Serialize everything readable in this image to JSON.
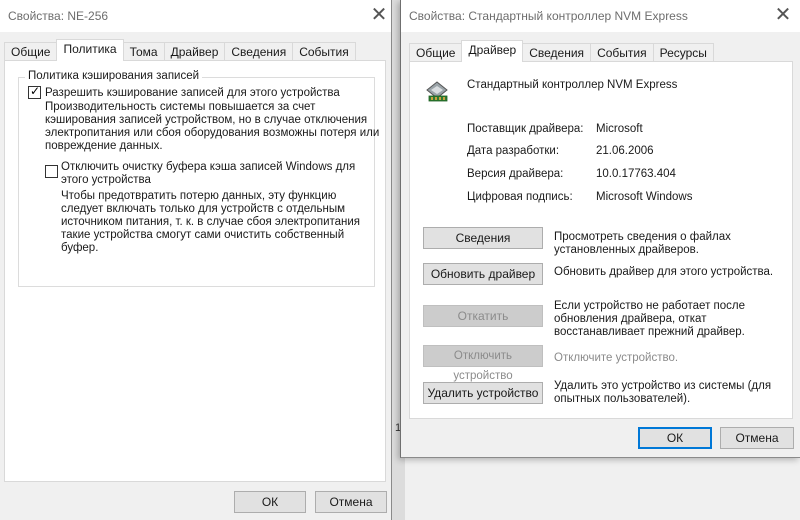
{
  "win1": {
    "title": "Свойства: NE-256",
    "tabs": [
      "Общие",
      "Политика",
      "Тома",
      "Драйвер",
      "Сведения",
      "События"
    ],
    "active_tab": "Политика",
    "group_title": "Политика кэширования записей",
    "option1": {
      "label": "Разрешить кэширование записей для этого устройства",
      "checked": true,
      "desc": [
        "Производительность системы повышается за счет",
        "кэширования записей устройством, но в случае отключения",
        "электропитания или сбоя оборудования возможны потеря или",
        "повреждение данных."
      ]
    },
    "option2": {
      "label": [
        "Отключить очистку буфера кэша записей Windows для",
        "этого устройства"
      ],
      "checked": false,
      "desc": [
        "Чтобы предотвратить потерю данных, эту функцию",
        "следует включать только для устройств с отдельным",
        "источником питания, т. к. в случае сбоя электропитания",
        "такие устройства смогут сами очистить собственный",
        "буфер."
      ]
    },
    "ok_label": "ОК",
    "cancel_label": "Отмена"
  },
  "win2": {
    "title": "Свойства: Стандартный контроллер NVM Express",
    "tabs": [
      "Общие",
      "Драйвер",
      "Сведения",
      "События",
      "Ресурсы"
    ],
    "active_tab": "Драйвер",
    "device_name": "Стандартный контроллер NVM Express",
    "props": {
      "provider_label": "Поставщик драйвера:",
      "provider_value": "Microsoft",
      "date_label": "Дата разработки:",
      "date_value": "21.06.2006",
      "version_label": "Версия драйвера:",
      "version_value": "10.0.17763.404",
      "signer_label": "Цифровая подпись:",
      "signer_value": "Microsoft Windows"
    },
    "actions": {
      "details_label": "Сведения",
      "details_desc": [
        "Просмотреть сведения о файлах",
        "установленных драйверов."
      ],
      "update_label": "Обновить драйвер",
      "update_desc": [
        "Обновить драйвер для этого устройства."
      ],
      "rollback_label": "Откатить",
      "rollback_desc": [
        "Если устройство не работает после",
        "обновления драйвера, откат",
        "восстанавливает прежний драйвер."
      ],
      "disable_label": "Отключить устройство",
      "disable_desc": [
        "Отключите устройство."
      ],
      "uninstall_label": "Удалить устройство",
      "uninstall_desc": [
        "Удалить это устройство из системы (для",
        "опытных пользователей)."
      ]
    },
    "ok_label": "ОК",
    "cancel_label": "Отмена"
  },
  "background": {
    "fragment_char": "1"
  },
  "colors": {
    "accent": "#0078d7",
    "window_bg": "#f0f0f0",
    "panel_bg": "#ffffff",
    "disabled_text": "#8b8b8b"
  }
}
